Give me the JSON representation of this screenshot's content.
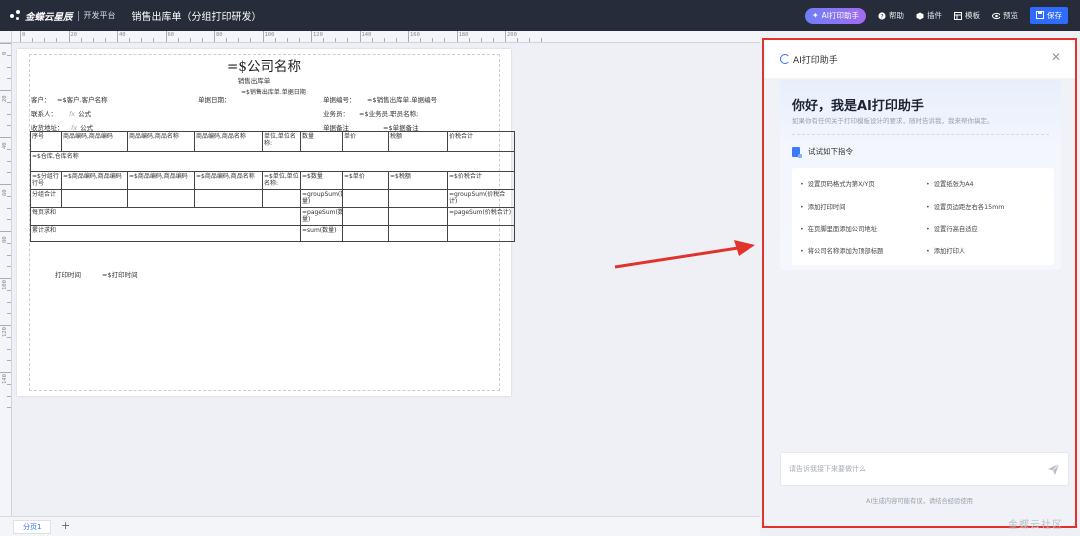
{
  "topbar": {
    "logo_text": "金蝶云星辰",
    "platform": "开发平台",
    "doc_title": "销售出库单（分组打印研发）",
    "ai_button": "AI打印助手",
    "help": "帮助",
    "plugin": "插件",
    "template": "模板",
    "preview": "预览",
    "save": "保存"
  },
  "rulers": {
    "h_labels": [
      "0",
      "20",
      "40",
      "60",
      "80",
      "100",
      "120",
      "140",
      "160",
      "180",
      "200"
    ],
    "v_labels": [
      "0",
      "20",
      "40",
      "60",
      "80",
      "100",
      "120",
      "140"
    ]
  },
  "paper": {
    "title": "=$公司名称",
    "subtitle": "销售出库单",
    "customer_label": "客户：",
    "customer_value": "=$客户.客户名称",
    "date_label": "单据日期：",
    "date_value": "=$销售出库单.单据日期",
    "number_label": "单据编号：",
    "number_value": "=$销售出库单.单据编号",
    "contact_label": "联系人：",
    "contact_value": "公式",
    "salesman_label": "业务员：",
    "salesman_value": "=$业务员.职员名称;",
    "address_label": "收货地址：",
    "address_value": "公式",
    "remark_label": "单据备注",
    "remark_value": "=$单据备注",
    "fx": "fx",
    "header_row": [
      "序号",
      "商品编码,商品编码",
      "商品编码,商品名称",
      "商品编码,商品名称",
      "单位,单位名称:",
      "数量",
      "单价",
      "税额",
      "价税合计"
    ],
    "group_row": "=$仓库,仓库名称",
    "detail_row": [
      "=$分组行行号",
      "=$商品编码,商品编码",
      "=$商品编码,商品编码",
      "=$商品编码,商品名称",
      "=$单位,单位名称:",
      "=$数量",
      "=$单价",
      "=$税额",
      "=$价税合计"
    ],
    "subtotal_label": "分组合计",
    "subtotal_qty": "=groupSum(数量)",
    "subtotal_total": "=groupSum(价税合计)",
    "page_label": "每页求和",
    "page_qty": "=pageSum(数量)",
    "page_total": "=pageSum(价税合计)",
    "cum_label": "累计求和",
    "cum_qty": "=sum(数量)",
    "print_time_label": "打印时间",
    "print_time_value": "=$打印时间"
  },
  "tabs": {
    "page_tab": "分页1",
    "add": "+"
  },
  "ai_panel": {
    "title": "AI打印助手",
    "welcome_title": "你好，我是AI打印助手",
    "welcome_desc": "如果你有任何关于打印模板设计的要求，随时告诉我，我来帮你搞定。",
    "try_label": "试试如下指令",
    "commands": [
      "设置页码格式为第X/Y页",
      "设置纸张为A4",
      "添加打印时间",
      "设置页边距左右各15mm",
      "在页脚里面添加公司地址",
      "设置行高自适应",
      "将公司名称添加为顶部标题",
      "添加打印人"
    ],
    "input_placeholder": "请告诉我接下来要做什么",
    "footer": "AI生成内容可能有误，请结合经验使用"
  },
  "watermark": "金蝶云社区",
  "colors": {
    "topbar": "#272c3a",
    "accent": "#2f6bff",
    "highlight_border": "#e0332b",
    "arrow": "#e0332b"
  }
}
